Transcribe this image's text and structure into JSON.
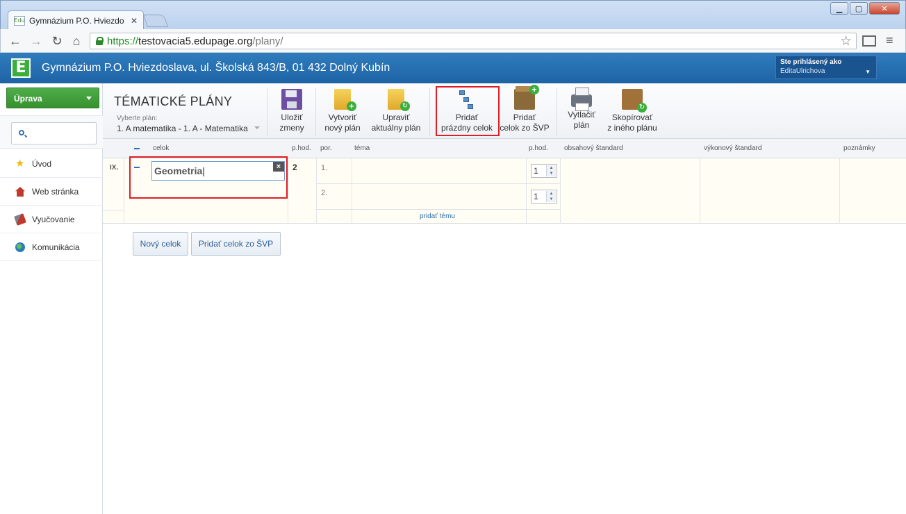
{
  "browser": {
    "tab_title": "Gymnázium P.O. Hviezdo",
    "tab_favicon": "Edu",
    "url_scheme": "https://",
    "url_host": "testovacia5.edupage.org",
    "url_path": "/plany/"
  },
  "header": {
    "logo": "E",
    "school_name": "Gymnázium P.O. Hviezdoslava, ul. Školská 843/B, 01 432 Dolný Kubín",
    "user_label": "Ste prihlásený ako",
    "user_name": "EditaUlrichova"
  },
  "sidebar": {
    "menu_button": "Úprava",
    "items": [
      {
        "label": "Úvod",
        "icon": "star-icon"
      },
      {
        "label": "Web stránka",
        "icon": "house-icon"
      },
      {
        "label": "Vyučovanie",
        "icon": "teacher-icon"
      },
      {
        "label": "Komunikácia",
        "icon": "globe-icon"
      }
    ]
  },
  "ribbon": {
    "title": "TÉMATICKÉ PLÁNY",
    "select_label": "Vyberte plán:",
    "select_value": "1. A matematika - 1. A - Matematika",
    "buttons": [
      {
        "l1": "Uložiť",
        "l2": "zmeny"
      },
      {
        "l1": "Vytvoriť",
        "l2": "nový plán"
      },
      {
        "l1": "Upraviť",
        "l2": "aktuálny plán"
      },
      {
        "l1": "Pridať",
        "l2": "prázdny celok"
      },
      {
        "l1": "Pridať",
        "l2": "celok zo ŠVP"
      },
      {
        "l1": "Vytlačiť",
        "l2": "plán"
      },
      {
        "l1": "Skopírovať",
        "l2": "z iného plánu"
      }
    ]
  },
  "table": {
    "columns": {
      "celok": "celok",
      "phod": "p.hod.",
      "por": "por.",
      "tema": "téma",
      "phod2": "p.hod.",
      "obsahovy": "obsahový štandard",
      "vykonovy": "výkonový štandard",
      "poznamky": "poznámky"
    },
    "row": {
      "month": "IX.",
      "celok_value": "Geometria",
      "hours": "2",
      "topics": [
        {
          "por": "1.",
          "hours": "1"
        },
        {
          "por": "2.",
          "hours": "1"
        }
      ],
      "add_topic": "pridať tému"
    }
  },
  "actions": {
    "new_unit": "Nový celok",
    "add_from_svp": "Pridať celok zo ŠVP"
  },
  "colors": {
    "header_blue": "#1e64a5",
    "accent_green": "#3cae3c",
    "highlight_red": "#e01e26"
  }
}
